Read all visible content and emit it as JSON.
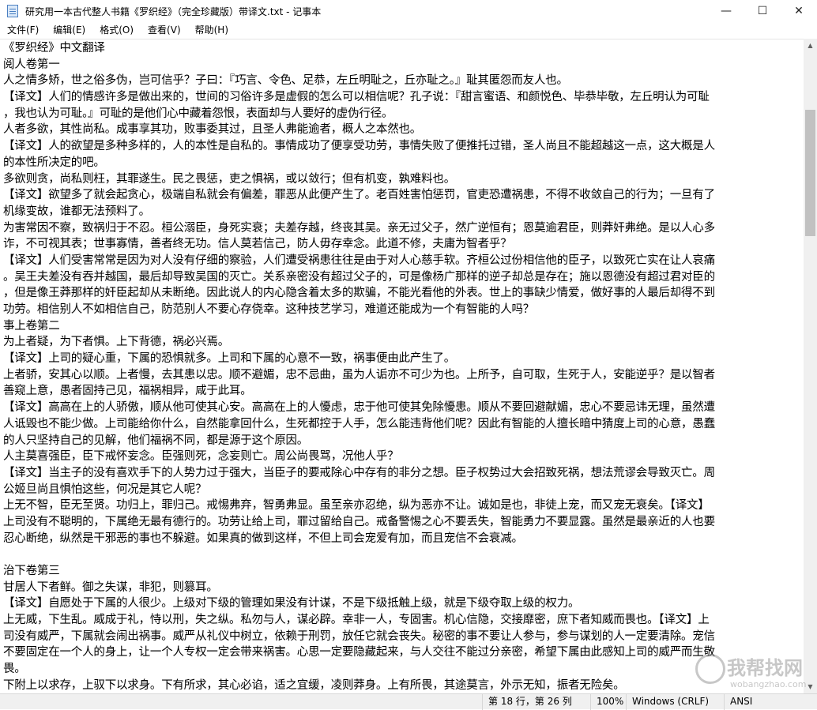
{
  "window": {
    "title": "研究用一本古代整人书籍《罗织经》（完全珍藏版）带译文.txt - 记事本",
    "minimize": "—",
    "maximize": "☐",
    "close": "✕"
  },
  "menu": [
    "文件(F)",
    "编辑(E)",
    "格式(O)",
    "查看(V)",
    "帮助(H)"
  ],
  "lines": [
    "《罗织经》中文翻译",
    "阅人卷第一",
    "人之情多矫，世之俗多伪，岂可信乎？子曰：『巧言、令色、足恭，左丘明耻之，丘亦耻之。』耻其匿怨而友人也。",
    "【译文】人们的情感许多是做出来的，世间的习俗许多是虚假的怎么可以相信呢？孔子说：『甜言蜜语、和颜悦色、毕恭毕敬，左丘明认为可耻",
    "，我也认为可耻。』可耻的是他们心中藏着怨恨，表面却与人要好的虚伪行径。",
    "人者多欲，其性尚私。成事享其功，败事委其过，且圣人弗能逾者，概人之本然也。",
    "【译文】人的欲望是多种多样的，人的本性是自私的。事情成功了便享受功劳，事情失败了便推托过错，圣人尚且不能超越这一点，这大概是人",
    "的本性所决定的吧。",
    "多欲则贪，尚私则枉，其罪遂生。民之畏惩，吏之惧祸，或以敛行；但有机变，孰难料也。",
    "【译文】欲望多了就会起贪心，极端自私就会有偏差，罪恶从此便产生了。老百姓害怕惩罚，官吏恐遭祸患，不得不收敛自己的行为；一旦有了",
    "机缘变故，谁都无法预料了。",
    "为害常因不察，致祸归于不忍。桓公溺臣，身死实衰；夫差存越，终丧其吴。亲无过父子，然广逆恒有；恩莫逾君臣，则莽奸弗绝。是以人心多",
    "诈，不可视其表；世事寡情，善者终无功。信人莫若信己，防人毋存幸念。此道不修，夫庸为智者乎？",
    "【译文】人们受害常常是因为对人没有仔细的察验，人们遭受祸患往往是由于对人心慈手软。齐桓公过份相信他的臣子，以致死亡实在让人哀痛",
    "。吴王夫差没有吞并越国，最后却导致吴国的灭亡。关系亲密没有超过父子的，可是像杨广那样的逆子却总是存在；施以恩德没有超过君对臣的",
    "，但是像王莽那样的奸臣起却从未断绝。因此说人的内心隐含着太多的欺骗，不能光看他的外表。世上的事缺少情爱，做好事的人最后却得不到",
    "功劳。相信别人不如相信自己，防范别人不要心存侥幸。这种技艺学习，难道还能成为一个有智能的人吗？",
    "事上卷第二",
    "为上者疑，为下者惧。上下背德，祸必兴焉。",
    "【译文】上司的疑心重，下属的恐惧就多。上司和下属的心意不一致，祸事便由此产生了。",
    "上者骄，安其心以顺。上者慢，去其患以忠。顺不避媚，忠不忌曲，虽为人诟亦不可少为也。上所予，自可取，生死于人，安能逆乎？是以智者",
    "善窥上意，愚者固持己见，福祸相异，咸于此耳。",
    "【译文】高高在上的人骄傲，顺从他可使其心安。高高在上的人懮虑，忠于他可使其免除懮患。顺从不要回避献媚，忠心不要忌讳无理，虽然遭",
    "人诋毁也不能少做。上司能给你什么，自然能拿回什么，生死都控于人手，怎么能违背他们呢？因此有智能的人擅长暗中猜度上司的心意，愚蠢",
    "的人只坚持自己的见解，他们福祸不同，都是源于这个原因。",
    "人主莫喜强臣，臣下戒怀妄念。臣强则死，念妄则亡。周公尚畏骂，况他人乎？",
    "【译文】当主子的没有喜欢手下的人势力过于强大，当臣子的要戒除心中存有的非分之想。臣子权势过大会招致死祸，想法荒谬会导致灭亡。周",
    "公姬旦尚且惧怕这些，何况是其它人呢？",
    "上无不智，臣无至贤。功归上，罪归己。戒惕弗弃，智勇弗显。虽至亲亦忍绝，纵为恶亦不让。诚如是也，非徒上宠，而又宠无衰矣。【译文】",
    "上司没有不聪明的，下属绝无最有德行的。功劳让给上司，罪过留给自己。戒备警惕之心不要丢失，智能勇力不要显露。虽然是最亲近的人也要",
    "忍心断绝，纵然是干邪恶的事也不躲避。如果真的做到这样，不但上司会宠爱有加，而且宠信不会衰减。",
    "",
    "治下卷第三",
    "甘居人下者鲜。御之失谋，非犯，则篡耳。",
    "【译文】自愿处于下属的人很少。上级对下级的管理如果没有计谋，不是下级抵触上级，就是下级夺取上级的权力。",
    "上无威，下生乱。威成于礼，恃以刑，失之纵。私勿与人，谋必辟。幸非一人，专固害。机心信隐，交接靡密，庶下者知威而畏也。【译文】上",
    "司没有威严，下属就会闹出祸事。威严从礼仪中树立，依赖于刑罚，放任它就会丧失。秘密的事不要让人参与，参与谋划的人一定要清除。宠信",
    "不要固定在一个人的身上，让一个人专权一定会带来祸害。心思一定要隐藏起来，与人交往不能过分亲密，希望下属由此感知上司的威严而生敬",
    "畏。",
    "下附上以求存，上驭下以求身。下有所求，其心必谄，适之宜缓，凌则莽身。上有所畏，其途莫言，外示无知，振者无险矣。"
  ],
  "status": {
    "position": "第 18 行，第 26 列",
    "zoom": "100%",
    "line_ending": "Windows (CRLF)",
    "encoding": "ANSI"
  },
  "watermark": {
    "main": "我帮找网",
    "sub": "wobangzhao.com"
  }
}
